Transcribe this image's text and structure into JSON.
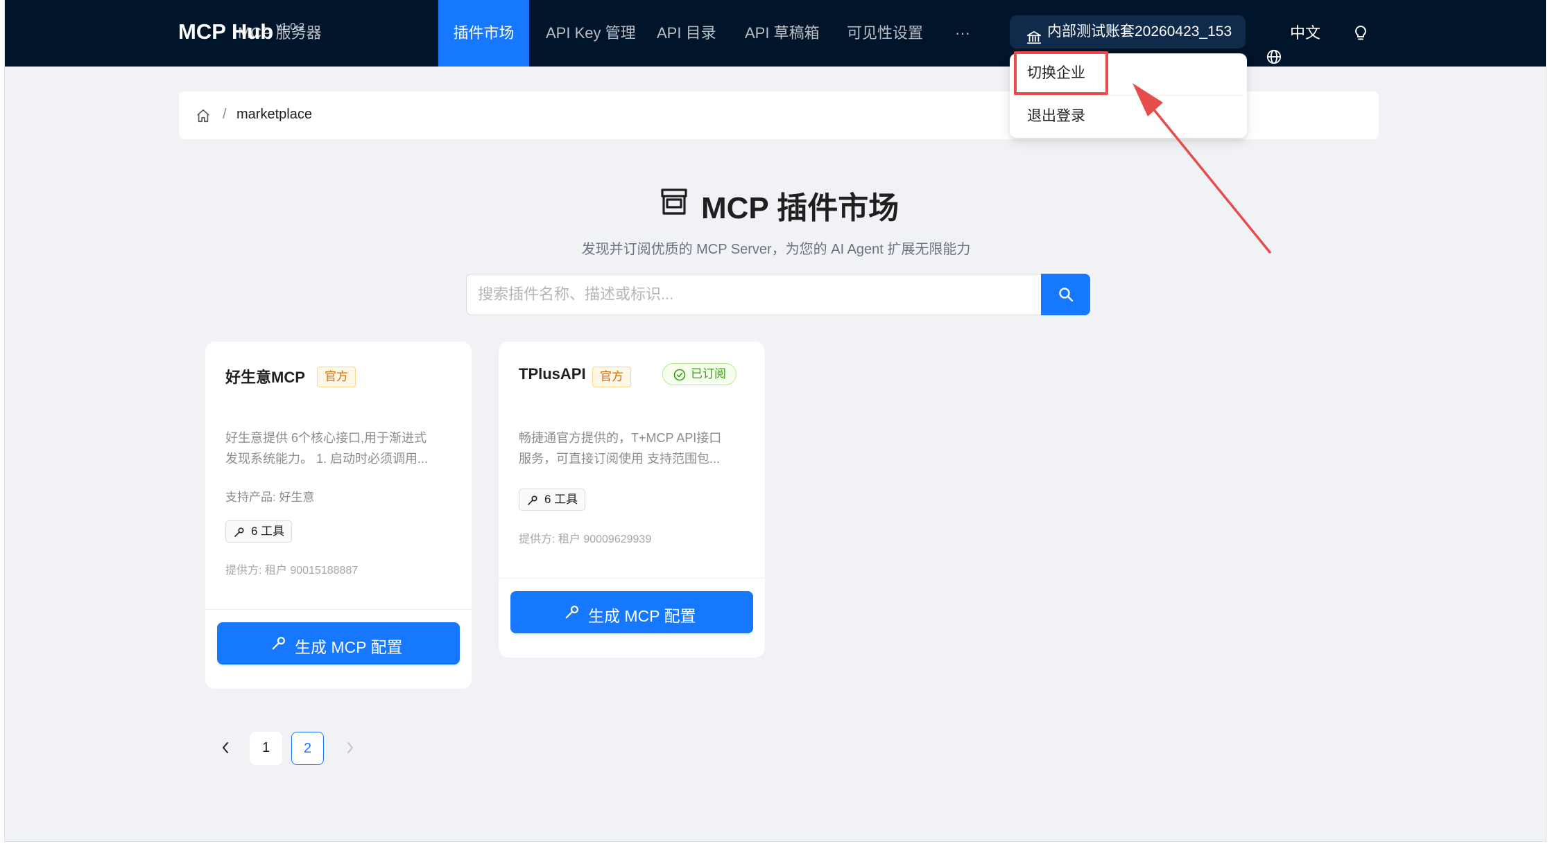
{
  "header": {
    "brand": "MCP Hub",
    "version": "v1.0.2",
    "nav": {
      "servers": "MCP 服务器",
      "marketplace": "插件市场",
      "apikeys": "API Key 管理",
      "catalog": "API 目录",
      "drafts": "API 草稿箱",
      "visibility": "可见性设置",
      "more": "···"
    },
    "tenant": "内部测试账套20260423_153",
    "language": "中文"
  },
  "dropdown": {
    "switch": "切换企业",
    "logout": "退出登录"
  },
  "breadcrumb": {
    "current": "marketplace",
    "separator": "/"
  },
  "hero": {
    "title": "MCP 插件市场",
    "subtitle": "发现并订阅优质的 MCP Server，为您的 AI Agent 扩展无限能力"
  },
  "search": {
    "placeholder": "搜索插件名称、描述或标识..."
  },
  "cards": [
    {
      "name": "好生意MCP",
      "official": "官方",
      "desc_line1": "好生意提供 6个核心接口,用于渐进式",
      "desc_line2": "发现系统能力。 1. 启动时必须调用...",
      "product": "支持产品: 好生意",
      "tools": "6 工具",
      "provider": "提供方: 租户 90015188887",
      "button": "生成 MCP 配置"
    },
    {
      "name": "TPlusAPI",
      "official": "官方",
      "subscribed": "已订阅",
      "desc_line1": "畅捷通官方提供的，T+MCP API接口",
      "desc_line2": "服务，可直接订阅使用 支持范围包...",
      "tools": "6 工具",
      "provider": "提供方: 租户 90009629939",
      "button": "生成 MCP 配置"
    }
  ],
  "pagination": {
    "pages": [
      "1",
      "2"
    ],
    "current": "2"
  },
  "colors": {
    "nav_bg": "#001529",
    "primary": "#1677ff",
    "highlight": "#e74c4c",
    "page_bg": "#f0f2f6"
  },
  "icons": {
    "tenant": "bank-icon",
    "language": "globe-icon",
    "theme": "lightbulb-icon",
    "home": "home-icon",
    "title": "shop-icon",
    "search": "search-icon",
    "tool": "wrench-icon",
    "subscribed": "check-circle-icon"
  }
}
